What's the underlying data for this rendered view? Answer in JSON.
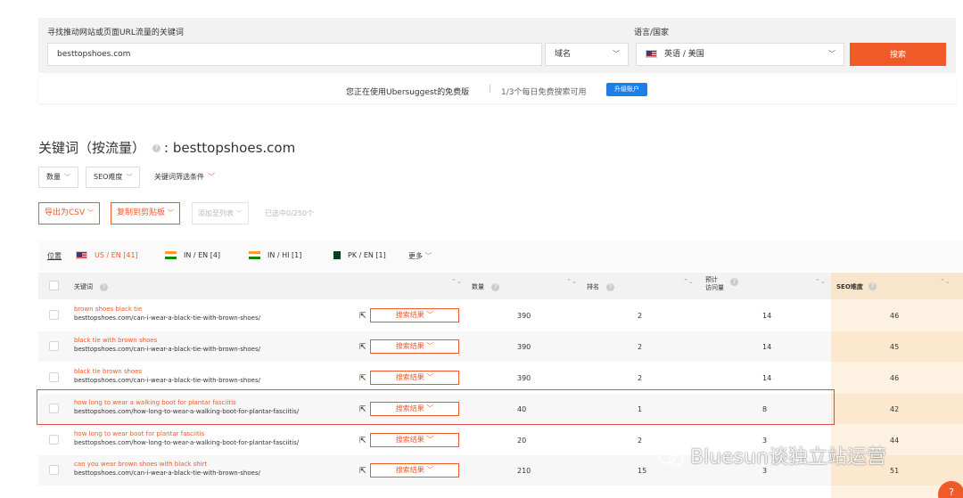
{
  "search": {
    "label": "寻找推动网站或页面URL流量的关键词",
    "lang_label": "语言/国家",
    "query": "besttopshoes.com",
    "scope": "域名",
    "language": "英语 / 美国",
    "button": "搜索"
  },
  "notice": {
    "plan_text": "您正在使用Ubersuggest的免费版",
    "separator": "|",
    "quota_text": "1/3个每日免费搜索可用",
    "upgrade": "升级账户"
  },
  "heading": {
    "title": "关键词（按流量）",
    "help": "?",
    "domain": ": besttopshoes.com"
  },
  "filters": {
    "volume": "数量",
    "seo_difficulty": "SEO难度",
    "keyword_filters": "关键词筛选条件",
    "chev": "﹀"
  },
  "actions": {
    "export_csv": "导出为CSV",
    "copy_clipboard": "复制到剪贴板",
    "add_to_list": "添加至列表",
    "selected": "已选中0/250个",
    "chev": "﹀"
  },
  "locales": {
    "label": "位置",
    "items": [
      "US / EN [41]",
      "IN / EN [4]",
      "IN / HI [1]",
      "PK / EN [1]"
    ],
    "more": "更多",
    "more_chev": "﹀"
  },
  "table": {
    "headers": {
      "keyword": "关键词",
      "volume": "数量",
      "rank": "排名",
      "visits_line1": "预计",
      "visits_line2": "访问量",
      "seo": "SEO难度",
      "help": "?"
    },
    "sort_icon": "⌃⌄",
    "ext_icon": "⇱",
    "serp_label": "搜索结果 ﹀",
    "rows": [
      {
        "keyword": "brown shoes black tie",
        "url": "besttopshoes.com/can-i-wear-a-black-tie-with-brown-shoes/",
        "volume": "390",
        "rank": "2",
        "visits": "14",
        "seo": "46"
      },
      {
        "keyword": "black tie with brown shoes",
        "url": "besttopshoes.com/can-i-wear-a-black-tie-with-brown-shoes/",
        "volume": "390",
        "rank": "2",
        "visits": "14",
        "seo": "45"
      },
      {
        "keyword": "black tie brown shoes",
        "url": "besttopshoes.com/can-i-wear-a-black-tie-with-brown-shoes/",
        "volume": "390",
        "rank": "2",
        "visits": "14",
        "seo": "46"
      },
      {
        "keyword": "how long to wear a walking boot for plantar fasciitis",
        "url": "besttopshoes.com/how-long-to-wear-a-walking-boot-for-plantar-fasciitis/",
        "volume": "40",
        "rank": "1",
        "visits": "8",
        "seo": "42"
      },
      {
        "keyword": "how long to wear boot for plantar fasciitis",
        "url": "besttopshoes.com/how-long-to-wear-a-walking-boot-for-plantar-fasciitis/",
        "volume": "20",
        "rank": "2",
        "visits": "3",
        "seo": "44"
      },
      {
        "keyword": "can you wear brown shoes with black shirt",
        "url": "besttopshoes.com/can-i-wear-a-black-tie-with-brown-shoes/",
        "volume": "210",
        "rank": "15",
        "visits": "3",
        "seo": "51"
      }
    ]
  },
  "watermark": "Bluesun谈独立站运营",
  "help_fab": "?",
  "colors": {
    "accent": "#f05a28",
    "upgrade": "#1f7de6",
    "seo_col": "#fdf1e2",
    "highlight": "#e04a4a"
  }
}
